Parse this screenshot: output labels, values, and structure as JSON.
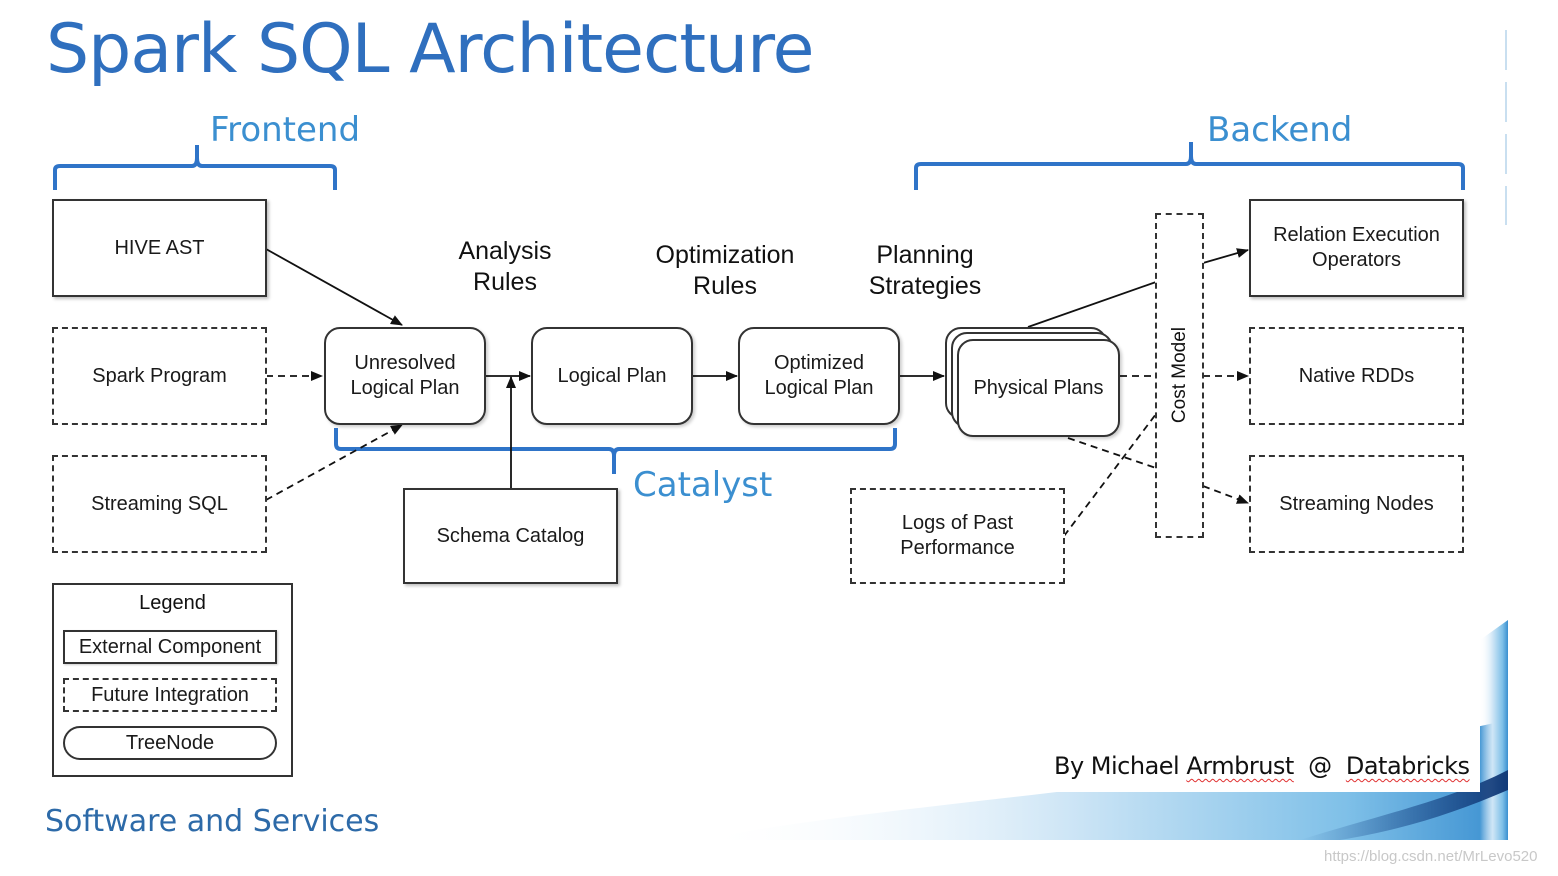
{
  "title": "Spark SQL Architecture",
  "sections": {
    "frontend": "Frontend",
    "backend": "Backend",
    "catalyst": "Catalyst"
  },
  "rule_labels": {
    "analysis": [
      "Analysis",
      "Rules"
    ],
    "optimization": [
      "Optimization",
      "Rules"
    ],
    "planning": [
      "Planning",
      "Strategies"
    ]
  },
  "inputs": {
    "hive_ast": "HIVE AST",
    "spark_program": "Spark Program",
    "streaming_sql": "Streaming SQL"
  },
  "plans": {
    "unresolved": [
      "Unresolved",
      "Logical Plan"
    ],
    "logical": "Logical Plan",
    "optimized": [
      "Optimized",
      "Logical Plan"
    ],
    "physical": "Physical Plans"
  },
  "schema_catalog": "Schema Catalog",
  "logs": [
    "Logs of Past",
    "Performance"
  ],
  "cost_model": "Cost Model",
  "outputs": {
    "relation_execution": [
      "Relation Execution",
      "Operators"
    ],
    "native_rdds": "Native RDDs",
    "streaming_nodes": "Streaming Nodes"
  },
  "legend": {
    "title": "Legend",
    "external": "External Component",
    "future": "Future Integration",
    "treenode": "TreeNode"
  },
  "footer": {
    "left": "Software and Services",
    "by": "By Michael",
    "author_last": "Armbrust",
    "at": "@",
    "company": "Databricks"
  },
  "watermark": "https://blog.csdn.net/MrLevo520",
  "colors": {
    "title_blue": "#2f6fbe",
    "section_blue": "#3b8fd0",
    "brace_blue": "#2f74c8"
  }
}
